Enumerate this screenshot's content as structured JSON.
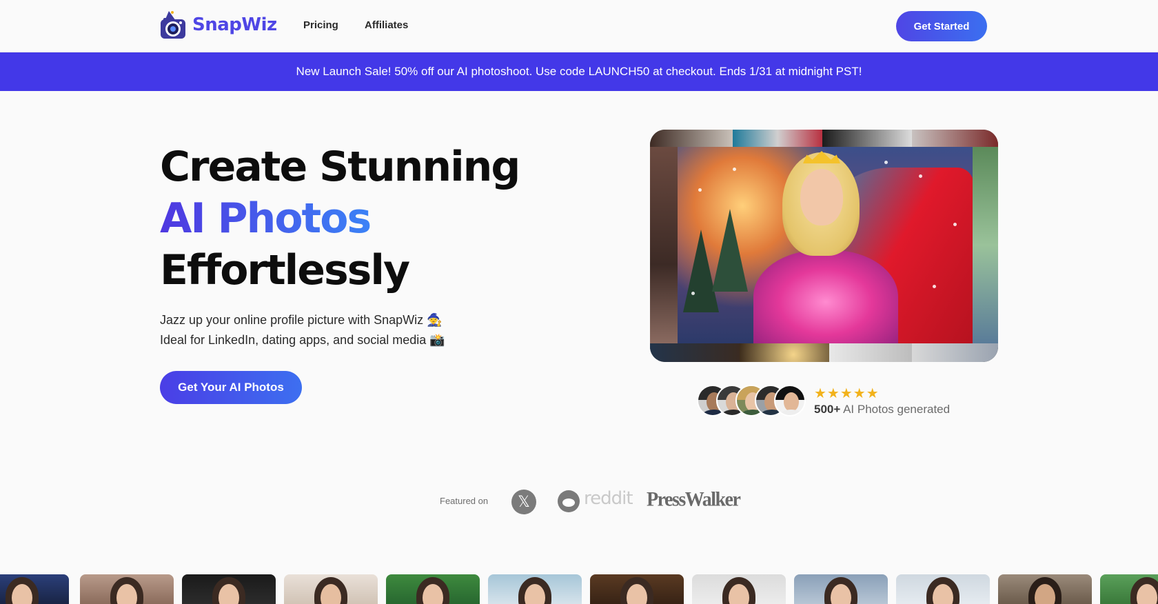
{
  "header": {
    "brand": "SnapWiz",
    "nav": [
      {
        "label": "Pricing"
      },
      {
        "label": "Affiliates"
      }
    ],
    "cta": "Get Started"
  },
  "banner": {
    "text": "New Launch Sale! 50% off our AI photoshoot. Use code LAUNCH50 at checkout. Ends 1/31 at midnight PST!"
  },
  "hero": {
    "title_line1": "Create Stunning",
    "title_line2": "AI Photos",
    "title_line3": "Effortlessly",
    "subtitle_line1": "Jazz up your online profile picture with SnapWiz 🧙",
    "subtitle_line2": "Ideal for LinkedIn, dating apps, and social media 📸",
    "cta": "Get Your AI Photos"
  },
  "social_proof": {
    "stars": "★★★★★",
    "rating": 5,
    "count": "500+",
    "label": "AI Photos generated"
  },
  "featured": {
    "label": "Featured on",
    "outlets": [
      "X",
      "reddit",
      "PressWalker"
    ],
    "presswalker_text": "PressWalker",
    "reddit_text": "reddit",
    "x_glyph": "𝕏"
  },
  "colors": {
    "primary": "#4f46e5",
    "banner": "#4338e8",
    "accent_gradient_end": "#3b82f6",
    "star": "#f2b21b"
  }
}
